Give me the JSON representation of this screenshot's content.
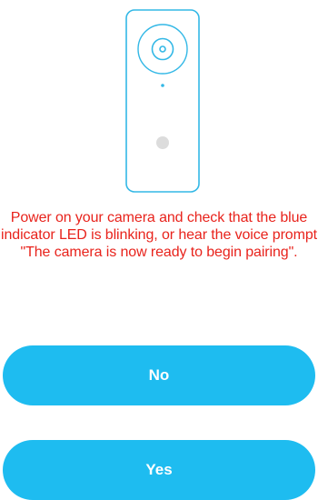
{
  "instruction": {
    "text": "Power on your camera and check that the blue indicator LED is blinking, or hear the voice prompt \"The camera is now ready to begin pairing\".",
    "color": "#e8231c"
  },
  "buttons": {
    "no_label": "No",
    "yes_label": "Yes",
    "color": "#1ebcf0"
  },
  "illustration": {
    "icon": "camera-icon",
    "stroke_color": "#33b8e6",
    "indicator_color": "#dcdcdc"
  }
}
